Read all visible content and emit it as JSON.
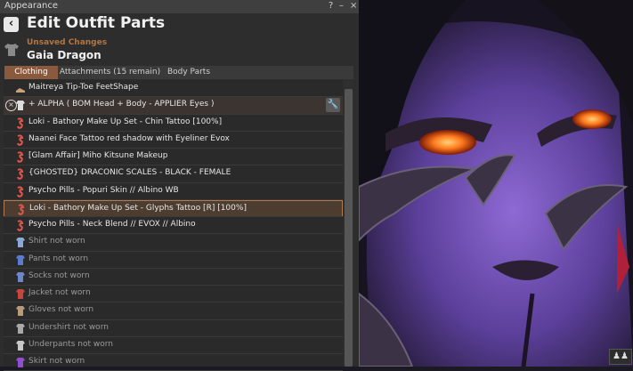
{
  "window": {
    "title": "Appearance",
    "help_label": "?",
    "minimize_label": "–",
    "close_label": "×"
  },
  "header": {
    "back_label": "‹",
    "title": "Edit Outfit Parts",
    "status": "Unsaved Changes",
    "outfit_name": "Gaia Dragon"
  },
  "tabs": [
    {
      "label": "Clothing",
      "active": true
    },
    {
      "label": "Attachments (15 remain)",
      "active": false
    },
    {
      "label": "Body Parts",
      "active": false
    }
  ],
  "items": [
    {
      "label": "Maitreya Tip-Toe FeetShape",
      "icon": "shoes-icon",
      "color": "#c9a27a",
      "state": "normal"
    },
    {
      "label": "+ ALPHA ( BOM Head + Body - APPLIER Eyes )",
      "icon": "shirt-icon",
      "color": "#dddddd",
      "state": "header"
    },
    {
      "label": "Loki - Bathory Make Up Set - Chin Tattoo [100%]",
      "icon": "tattoo-icon",
      "color": "#e0574f",
      "state": "normal"
    },
    {
      "label": "Naanei Face Tattoo red shadow with Eyeliner Evox",
      "icon": "tattoo-icon",
      "color": "#e0574f",
      "state": "normal"
    },
    {
      "label": "[Glam Affair] Miho Kitsune Makeup",
      "icon": "tattoo-icon",
      "color": "#e0574f",
      "state": "normal"
    },
    {
      "label": "{GHOSTED} DRACONIC SCALES - BLACK - FEMALE",
      "icon": "tattoo-icon",
      "color": "#e0574f",
      "state": "normal"
    },
    {
      "label": "Psycho Pills - Popuri Skin // Albino WB",
      "icon": "tattoo-icon",
      "color": "#e0574f",
      "state": "normal"
    },
    {
      "label": "Loki - Bathory Make Up Set - Glyphs Tattoo [R] [100%]",
      "icon": "tattoo-icon",
      "color": "#e0574f",
      "state": "selected"
    },
    {
      "label": "Psycho Pills - Neck Blend // EVOX // Albino",
      "icon": "tattoo-icon",
      "color": "#e0574f",
      "state": "normal"
    },
    {
      "label": "Shirt not worn",
      "icon": "shirt-icon",
      "color": "#8aa8d8",
      "state": "dim"
    },
    {
      "label": "Pants not worn",
      "icon": "pants-icon",
      "color": "#5a7bd0",
      "state": "dim"
    },
    {
      "label": "Socks not worn",
      "icon": "socks-icon",
      "color": "#6c86c8",
      "state": "dim"
    },
    {
      "label": "Jacket not worn",
      "icon": "jacket-icon",
      "color": "#c6453c",
      "state": "dim"
    },
    {
      "label": "Gloves not worn",
      "icon": "gloves-icon",
      "color": "#b89a7a",
      "state": "dim"
    },
    {
      "label": "Undershirt not worn",
      "icon": "undershirt-icon",
      "color": "#a8a8a8",
      "state": "dim"
    },
    {
      "label": "Underpants not worn",
      "icon": "underpants-icon",
      "color": "#c8c8c8",
      "state": "dim"
    },
    {
      "label": "Skirt not worn",
      "icon": "skirt-icon",
      "color": "#8f4fd0",
      "state": "dim"
    }
  ],
  "remove_label": "×",
  "edit_label": "🔧",
  "tray_label": "♟♟",
  "colors": {
    "accent": "#8a5a3f",
    "status": "#b07645",
    "selection_border": "#b07a52"
  }
}
